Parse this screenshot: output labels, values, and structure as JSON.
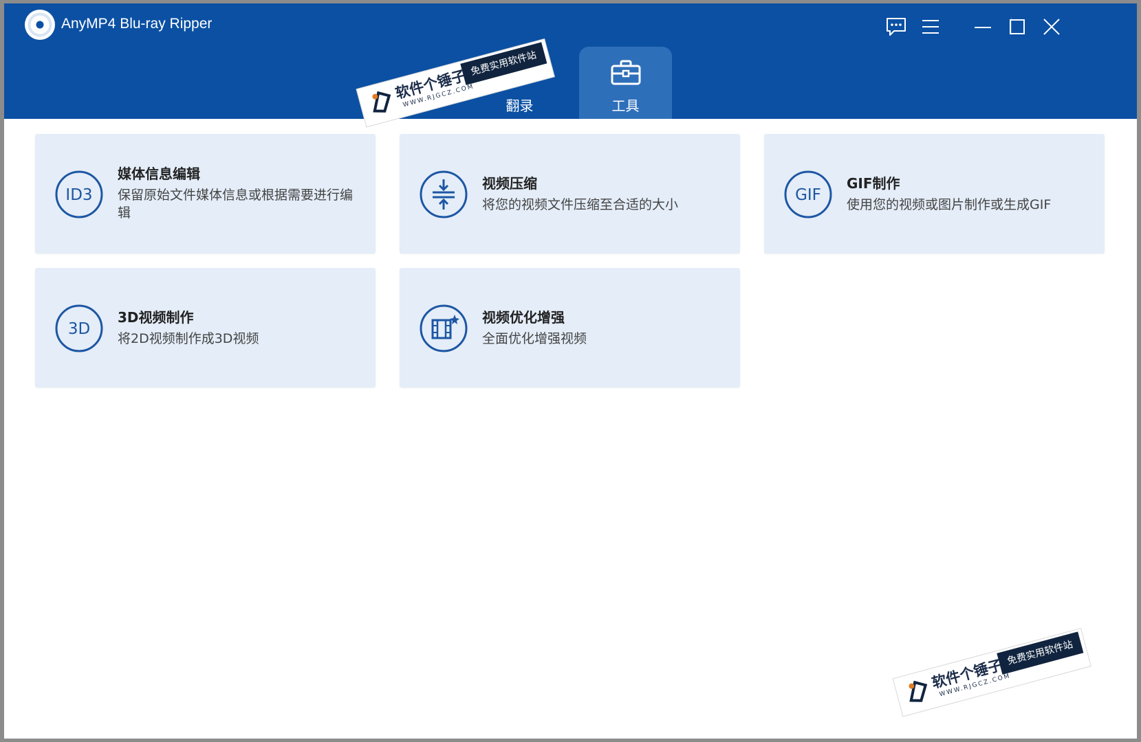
{
  "app": {
    "title": "AnyMP4 Blu-ray Ripper"
  },
  "colors": {
    "header": "#0b50a3",
    "active_tab": "#2e6fba",
    "card_bg": "#e4edf8",
    "icon_stroke": "#1d56a3"
  },
  "header_icons": [
    "feedback-icon",
    "menu-icon",
    "minimize-icon",
    "maximize-icon",
    "close-icon"
  ],
  "tabs": [
    {
      "label": "翻录",
      "icon": "ripper-icon",
      "active": false
    },
    {
      "label": "工具",
      "icon": "toolbox-icon",
      "active": true
    }
  ],
  "tools": [
    {
      "title": "媒体信息编辑",
      "description": "保留原始文件媒体信息或根据需要进行编辑",
      "icon_text": "ID3",
      "icon": "id3-icon"
    },
    {
      "title": "视频压缩",
      "description": "将您的视频文件压缩至合适的大小",
      "icon": "compress-icon"
    },
    {
      "title": "GIF制作",
      "description": "使用您的视频或图片制作或生成GIF",
      "icon_text": "GIF",
      "icon": "gif-icon"
    },
    {
      "title": "3D视频制作",
      "description": "将2D视频制作成3D视频",
      "icon_text": "3D",
      "icon": "3d-icon"
    },
    {
      "title": "视频优化增强",
      "description": "全面优化增强视频",
      "icon": "enhance-icon"
    }
  ],
  "watermark": {
    "main": "软件个锤子",
    "tagline": "免费实用软件站",
    "url": "WWW.RJGCZ.COM"
  }
}
